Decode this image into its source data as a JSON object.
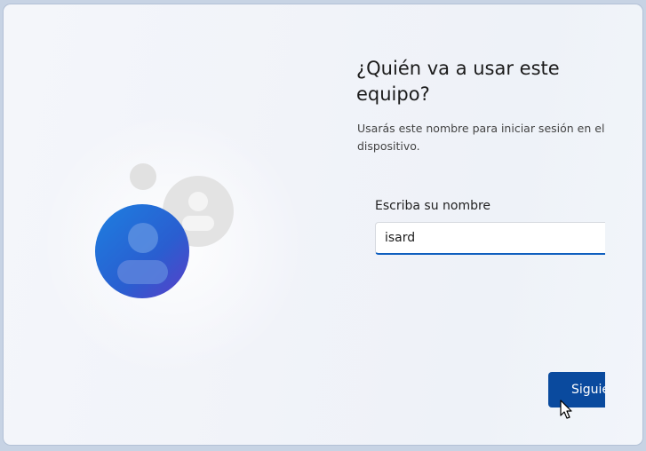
{
  "header": {
    "title": "¿Quién va a usar este equipo?",
    "subtitle": "Usarás este nombre para iniciar sesión en el dispositivo."
  },
  "form": {
    "name_label": "Escriba su nombre",
    "name_value": "isard"
  },
  "actions": {
    "next_label": "Siguiente"
  },
  "illustration": {
    "icon": "users-avatar-icon",
    "primary_color": "#1a73d8",
    "secondary_color": "#e2e2e2"
  },
  "colors": {
    "accent": "#0a4a9e",
    "input_focus": "#0f5fbf",
    "background": "#f2f4f9"
  }
}
